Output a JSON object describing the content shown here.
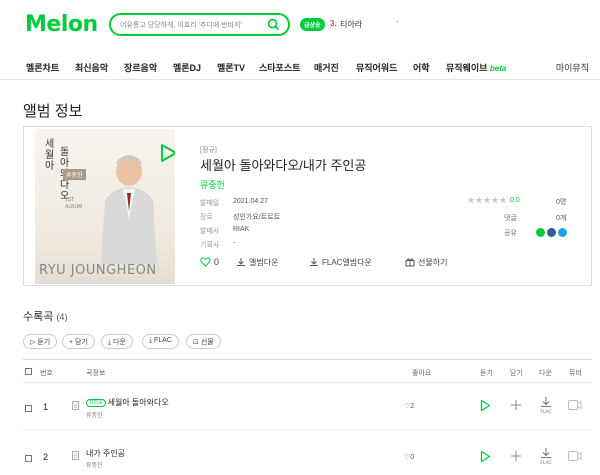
{
  "header": {
    "logo": "Melon",
    "search_placeholder": "어유롱고 당당하게, 이효리 '추디에 반바지'",
    "live_badge": "급상승",
    "rank_num": "3.",
    "rank_name": "티아라",
    "rank_extra": "·"
  },
  "gnb": {
    "items": [
      "멜론차트",
      "최신음악",
      "장르음악",
      "멜론DJ",
      "멜론TV",
      "스타포스트",
      "매거진",
      "뮤직어워드",
      "어학",
      "뮤직웨이브"
    ],
    "beta": "beta",
    "right": "마이뮤직"
  },
  "page_title": "앨범 정보",
  "album": {
    "cover": {
      "title_col1": "세월아",
      "title_col2": "돌아와다오",
      "artist_label": "류중헌",
      "small": "1ST ALBUM",
      "name": "RYU JOUNGHEON"
    },
    "type": "[정규]",
    "title": "세월아 돌아와다오/내가 주인공",
    "artist": "류중헌",
    "meta": [
      {
        "label": "발매일",
        "value": "2021.04.27"
      },
      {
        "label": "장르",
        "value": "성인가요/트로트"
      },
      {
        "label": "발매사",
        "value": "RIAK"
      },
      {
        "label": "기획사",
        "value": "-"
      }
    ],
    "rating": {
      "score": "0.0",
      "people": "0명",
      "stars_filled": 0
    },
    "comments_label": "댓글",
    "comments_value": "0개",
    "share_label": "공유",
    "share_colors": [
      "#00cd3c",
      "#3b5998",
      "#1da1f2"
    ],
    "actions": {
      "like_count": "0",
      "download": "앨범다운",
      "flac_download": "FLAC앨범다운",
      "gift": "선물하기"
    }
  },
  "tracks": {
    "title": "수록곡",
    "count": "(4)",
    "buttons": [
      "듣기",
      "담기",
      "다운",
      "FLAC",
      "선물"
    ],
    "headers": {
      "no": "번호",
      "info": "곡정보",
      "like": "좋아요",
      "play": "듣기",
      "add": "담기",
      "down": "다운",
      "mv": "뮤비"
    },
    "title_badge": "TITLE",
    "rows": [
      {
        "no": "1",
        "title": "세월아 돌아와다오",
        "artist": "류중헌",
        "likes": "2",
        "is_title": true
      },
      {
        "no": "2",
        "title": "내가 주인공",
        "artist": "류중헌",
        "likes": "0",
        "is_title": false
      }
    ]
  },
  "colors": {
    "accent": "#00cd3c",
    "rank": "#ff3c3c"
  }
}
